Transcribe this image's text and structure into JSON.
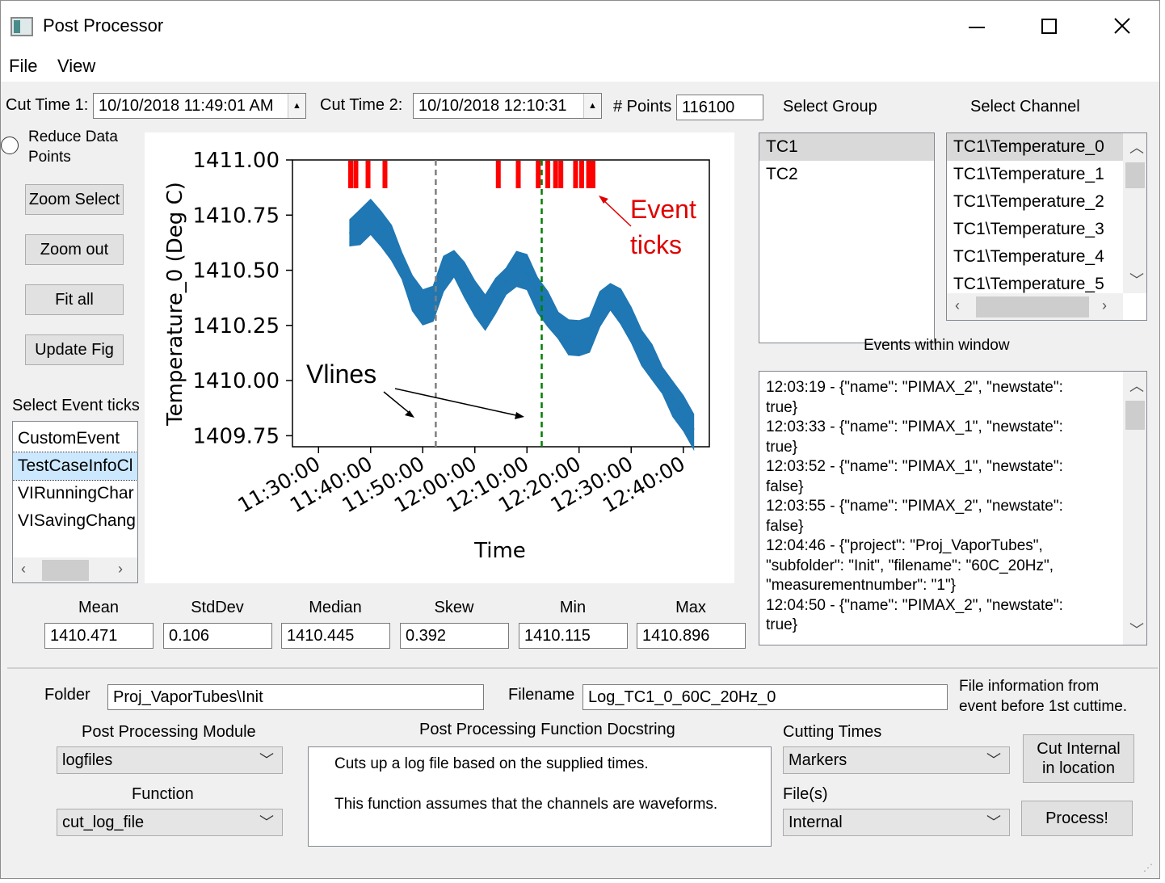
{
  "window": {
    "title": "Post Processor"
  },
  "menu": [
    "File",
    "View"
  ],
  "cut_time_1": {
    "label": "Cut Time 1:",
    "value": "10/10/2018 11:49:01 AM"
  },
  "cut_time_2": {
    "label": "Cut Time 2:",
    "value": "10/10/2018 12:10:31"
  },
  "points": {
    "label": "# Points",
    "value": "116100"
  },
  "select_group": {
    "label": "Select Group",
    "items": [
      "TC1",
      "TC2"
    ],
    "selected": 0
  },
  "select_channel": {
    "label": "Select Channel",
    "items": [
      "TC1\\Temperature_0",
      "TC1\\Temperature_1",
      "TC1\\Temperature_2",
      "TC1\\Temperature_3",
      "TC1\\Temperature_4",
      "TC1\\Temperature_5"
    ],
    "selected": 0
  },
  "reduce": {
    "label_line1": "Reduce Data",
    "label_line2": "Points"
  },
  "buttons": {
    "zoom_select": "Zoom Select",
    "zoom_out": "Zoom out",
    "fit_all": "Fit all",
    "update_fig": "Update Fig"
  },
  "event_ticks": {
    "label": "Select Event ticks",
    "items": [
      "CustomEvent",
      "TestCaseInfoCl",
      "VIRunningChar",
      "VISavingChang"
    ],
    "selected": 1
  },
  "events": {
    "label": "Events within window",
    "lines": [
      "12:03:19 - {\"name\": \"PIMAX_2\", \"newstate\":",
      "true}",
      "12:03:33 - {\"name\": \"PIMAX_1\", \"newstate\":",
      "true}",
      "12:03:52 - {\"name\": \"PIMAX_1\", \"newstate\":",
      "false}",
      "12:03:55 - {\"name\": \"PIMAX_2\", \"newstate\":",
      "false}",
      "12:04:46 - {\"project\": \"Proj_VaporTubes\",",
      "\"subfolder\": \"Init\", \"filename\": \"60C_20Hz\",",
      "\"measurementnumber\": \"1\"}",
      "12:04:50 - {\"name\": \"PIMAX_2\", \"newstate\":",
      "true}"
    ]
  },
  "stats": [
    {
      "label": "Mean",
      "value": "1410.471"
    },
    {
      "label": "StdDev",
      "value": "0.106"
    },
    {
      "label": "Median",
      "value": "1410.445"
    },
    {
      "label": "Skew",
      "value": "0.392"
    },
    {
      "label": "Min",
      "value": "1410.115"
    },
    {
      "label": "Max",
      "value": "1410.896"
    }
  ],
  "folder": {
    "label": "Folder",
    "value": "Proj_VaporTubes\\Init"
  },
  "filename": {
    "label": "Filename",
    "value": "Log_TC1_0_60C_20Hz_0"
  },
  "file_info_note": {
    "line1": "File information from",
    "line2": "event before 1st cuttime."
  },
  "module": {
    "label": "Post Processing Module",
    "value": "logfiles"
  },
  "function": {
    "label": "Function",
    "value": "cut_log_file"
  },
  "docstring": {
    "label": "Post Processing Function Docstring",
    "line1": "Cuts up a log file based on the supplied times.",
    "line2": "This function assumes that the channels are waveforms."
  },
  "cutting_times": {
    "label": "Cutting Times",
    "value": "Markers"
  },
  "files": {
    "label": "File(s)",
    "value": "Internal"
  },
  "cut_internal_button": {
    "line1": "Cut Internal",
    "line2": "in location"
  },
  "process_button": "Process!",
  "chart_data": {
    "type": "line",
    "xlabel": "Time",
    "ylabel": "Temperature_0 (Deg C)",
    "x_ticks": [
      "11:30:00",
      "11:40:00",
      "11:50:00",
      "12:00:00",
      "12:10:00",
      "12:20:00",
      "12:30:00",
      "12:40:00"
    ],
    "y_ticks": [
      "1411.00",
      "1410.75",
      "1410.50",
      "1410.25",
      "1410.00",
      "1409.75"
    ],
    "xlim": [
      "11:25:00",
      "12:45:00"
    ],
    "ylim": [
      1409.7,
      1411.0
    ],
    "series": [
      {
        "color": "#1f77b4",
        "x": [
          "11:36:00",
          "11:38:00",
          "11:40:00",
          "11:42:00",
          "11:44:00",
          "11:46:00",
          "11:48:00",
          "11:50:00",
          "11:52:00",
          "11:54:00",
          "11:56:00",
          "11:58:00",
          "12:00:00",
          "12:02:00",
          "12:04:00",
          "12:06:00",
          "12:08:00",
          "12:10:00",
          "12:12:00",
          "12:14:00",
          "12:16:00",
          "12:18:00",
          "12:20:00",
          "12:22:00",
          "12:24:00",
          "12:26:00",
          "12:28:00",
          "12:30:00",
          "12:32:00",
          "12:34:00",
          "12:36:00",
          "12:38:00",
          "12:40:00",
          "12:42:00"
        ],
        "values": [
          1410.67,
          1410.7,
          1410.73,
          1410.7,
          1410.62,
          1410.52,
          1410.4,
          1410.32,
          1410.36,
          1410.48,
          1410.53,
          1410.46,
          1410.36,
          1410.32,
          1410.38,
          1410.45,
          1410.51,
          1410.48,
          1410.4,
          1410.32,
          1410.25,
          1410.2,
          1410.18,
          1410.22,
          1410.32,
          1410.38,
          1410.34,
          1410.24,
          1410.16,
          1410.08,
          1410.0,
          1409.92,
          1409.84,
          1409.78
        ],
        "band": 0.12
      }
    ],
    "vlines": [
      {
        "x": "11:52:30",
        "color": "#7f7f7f",
        "style": "dashed"
      },
      {
        "x": "12:12:50",
        "color": "#008000",
        "style": "dashed"
      }
    ],
    "event_ticks": [
      "11:36:10",
      "11:37:10",
      "11:39:30",
      "11:42:45",
      "12:04:30",
      "12:08:20",
      "12:12:10",
      "12:14:00",
      "12:15:30",
      "12:16:30",
      "12:19:20",
      "12:20:30",
      "12:21:50",
      "12:22:40"
    ],
    "event_tick_color": "#ff0000",
    "annotations": [
      {
        "text_line1": "Event",
        "text_line2": "ticks",
        "color": "#e00000"
      },
      {
        "text": "Vlines",
        "color": "#000000"
      }
    ]
  }
}
